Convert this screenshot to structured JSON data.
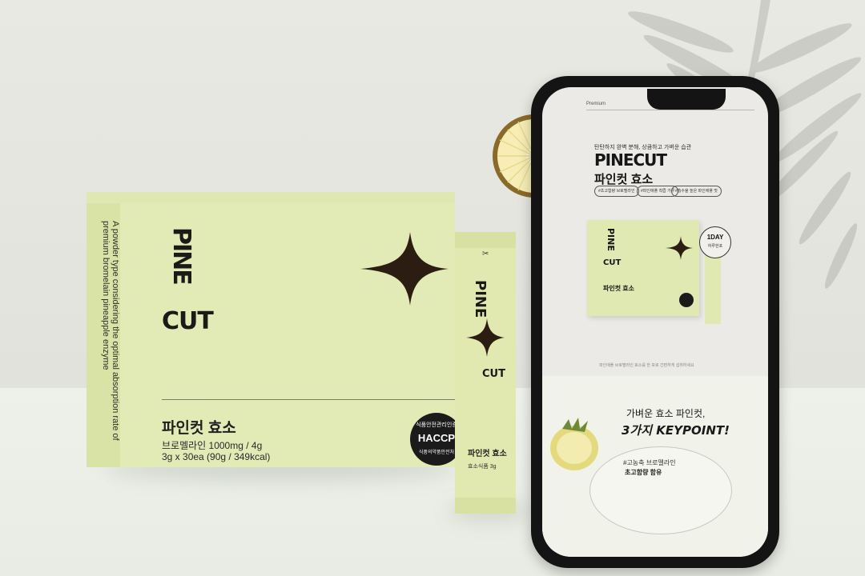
{
  "box": {
    "brand_line1": "PINE",
    "brand_line2": "CUT",
    "side_text": "A powder type considering the optimal absorption rate of premium bromelain pineapple enzyme",
    "product_name": "파인컷 효소",
    "spec_line1": "브로멜라인 1000mg / 4g",
    "spec_line2": "3g x 30ea (90g / 349kcal)",
    "haccp_top": "식품안전관리인증",
    "haccp_main": "HACCP",
    "haccp_bottom": "식품의약품안전처"
  },
  "stick": {
    "brand_line1": "PINE",
    "brand_line2": "CUT",
    "product_name": "파인컷 효소",
    "weight": "효소식품 3g"
  },
  "phone": {
    "header_label": "Premium",
    "tagline": "탄탄하지 완벽 분해, 상큼하고 가벼운 습관",
    "logo": "PINECUT",
    "product_name": "파인컷 효소",
    "pills": [
      "#초고함량 브로멜라인",
      "#파인애플 착즙 가루",
      "#흡수율 높은 파인애플 맛"
    ],
    "badge_main": "1DAY",
    "badge_sub": "하루한포",
    "mini_box_brand1": "PINE",
    "mini_box_brand2": "CUT",
    "mini_box_name": "파인컷 효소",
    "caption": "파인애플 브로멜라인 효소를 한 포로 간편하게 섭취하세요",
    "key_line1": "가벼운 효소 파인컷,",
    "key_line2": "3가지 KEYPOINT!",
    "feature_line1": "#고농축 브로멜라인",
    "feature_line2": "초고함량 함유"
  },
  "colors": {
    "package_green": "#e2eab6",
    "logo_black": "#1c1a16",
    "phone_frame": "#141414",
    "background": "#e9e9e4"
  }
}
